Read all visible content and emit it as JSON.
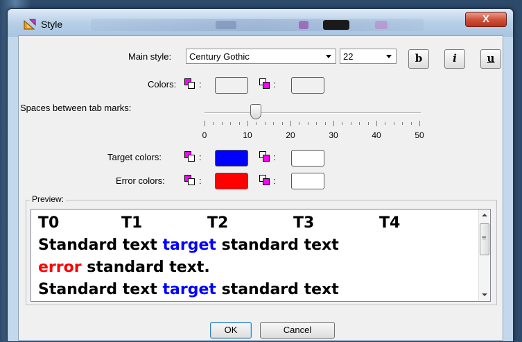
{
  "window": {
    "title": "Style",
    "close_label": "X"
  },
  "main_style": {
    "label": "Main style:",
    "font_value": "Century Gothic",
    "size_value": "22"
  },
  "format_buttons": {
    "bold": "b",
    "italic": "i",
    "underline": "u"
  },
  "colors": {
    "label": "Colors:",
    "fg_color": "#000000",
    "bg_color": "#ffffff"
  },
  "tab_marks": {
    "label": "Spaces between tab marks:",
    "value": 12,
    "min": 0,
    "max": 50,
    "tick_labels": [
      "0",
      "10",
      "20",
      "30",
      "40",
      "50"
    ]
  },
  "target_colors": {
    "label": "Target colors:",
    "fg_color": "#0000ff",
    "bg_color": "#ffffff"
  },
  "error_colors": {
    "label": "Error colors:",
    "fg_color": "#ff0000",
    "bg_color": "#ffffff"
  },
  "colon": ":",
  "preview": {
    "legend": "Preview:",
    "tab_headers": [
      "T0",
      "T1",
      "T2",
      "T3",
      "T4"
    ],
    "line1_a": "Standard text ",
    "line1_target": "target",
    "line1_b": " standard text",
    "line2_error": "error",
    "line2_b": " standard text.",
    "line3_a": "Standard text ",
    "line3_target": "target",
    "line3_b": " standard text"
  },
  "buttons": {
    "ok": "OK",
    "cancel": "Cancel"
  },
  "accent_colors": {
    "swatch_icon_back": "#ff00ff",
    "swatch_icon_front": "#ffffff"
  }
}
